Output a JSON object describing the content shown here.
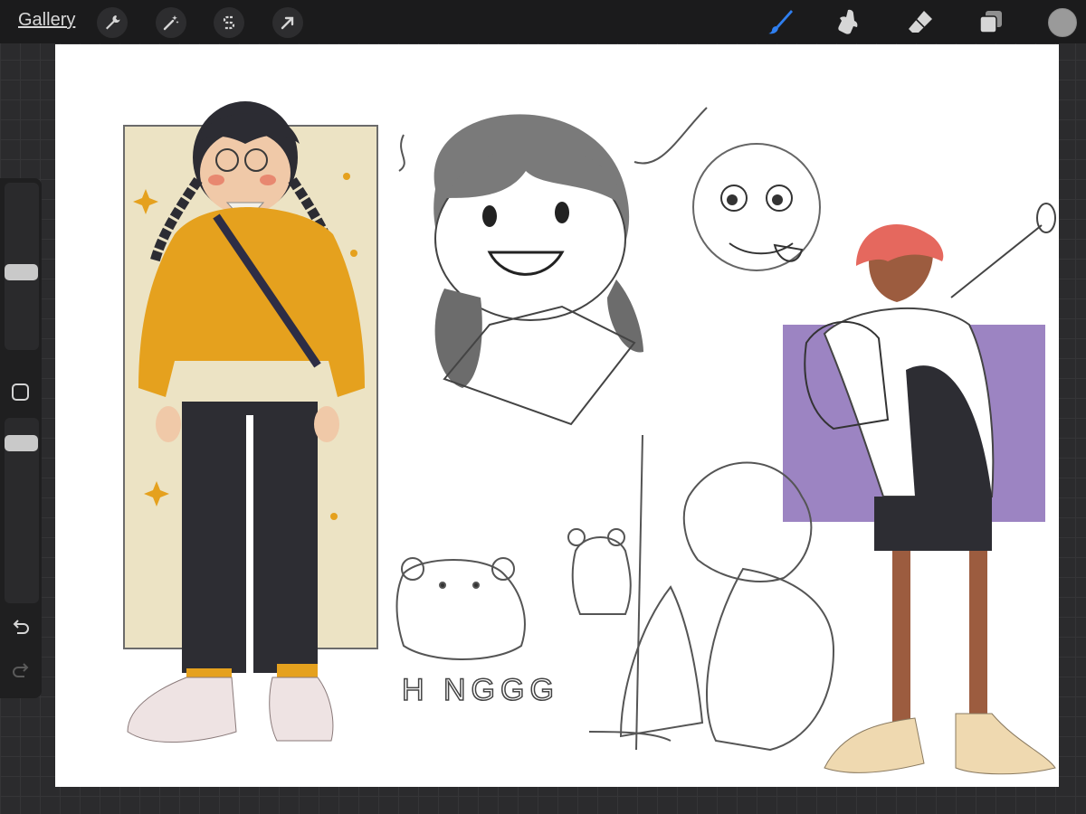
{
  "toolbar": {
    "gallery_label": "Gallery",
    "left_tools": [
      {
        "name": "actions-wrench",
        "icon": "wrench-icon"
      },
      {
        "name": "adjustments-magic-wand",
        "icon": "magic-wand-icon"
      },
      {
        "name": "selection",
        "icon": "selection-s-icon"
      },
      {
        "name": "transform-arrow",
        "icon": "transform-arrow-icon"
      }
    ],
    "right_tools": [
      {
        "name": "brush",
        "icon": "brush-icon",
        "active": true
      },
      {
        "name": "smudge",
        "icon": "smudge-icon",
        "active": false
      },
      {
        "name": "eraser",
        "icon": "eraser-icon",
        "active": false
      },
      {
        "name": "layers",
        "icon": "layers-icon",
        "active": false
      }
    ],
    "current_color": "#9a9a9a",
    "active_color": "#2f7ff0"
  },
  "sidebar": {
    "brush_size_value": 0.6,
    "opacity_value": 0.3,
    "modify_icon": "square-icon",
    "undo_icon": "undo-icon",
    "redo_icon": "redo-icon"
  },
  "canvas": {
    "sketch_text": "H NGGG",
    "colors": {
      "sweater": "#e5a11e",
      "backdrop_yellow": "#ece3c4",
      "backdrop_purple": "#9c84c2",
      "pants": "#2d2d33",
      "hair_red": "#e5685e",
      "skin_dark": "#9c5c3f"
    }
  }
}
